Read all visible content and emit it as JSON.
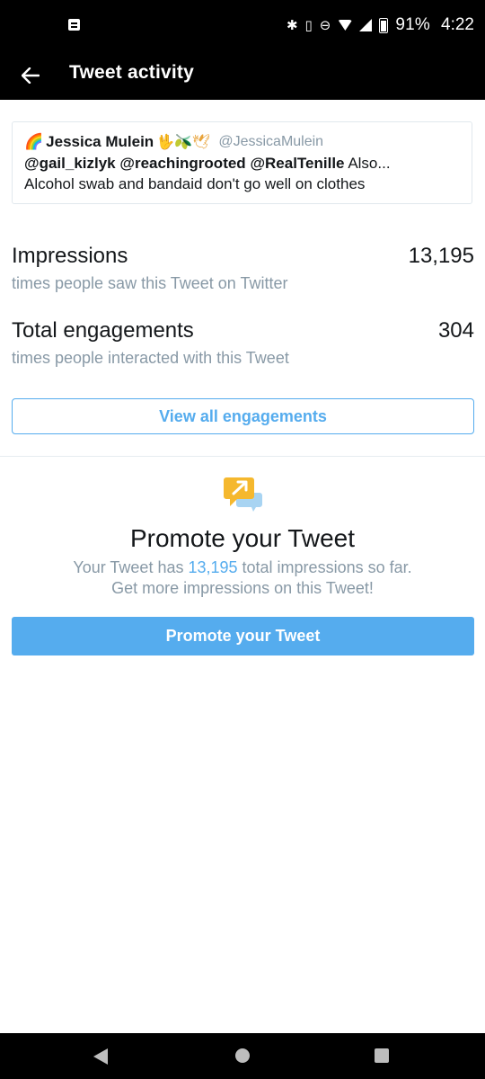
{
  "status_bar": {
    "battery": "91%",
    "time": "4:22",
    "icons": [
      "notification-icon",
      "bluetooth-icon",
      "vibrate-icon",
      "dnd-icon",
      "wifi-icon",
      "signal-icon",
      "battery-icon"
    ]
  },
  "app_bar": {
    "title": "Tweet activity",
    "back_icon": "arrow-left-icon"
  },
  "tweet": {
    "author_emoji_prefix": "🌈",
    "author_name": "Jessica Mulein",
    "author_emoji_suffix": "🖖🫒🕊",
    "handle": "@JessicaMulein",
    "mention1": "@gail_kizlyk",
    "mention2": "@reachingrooted",
    "mention3": "@RealTenille",
    "text_tail": "Also...",
    "line2": "Alcohol swab and bandaid don't go well on clothes"
  },
  "stats": {
    "impressions_label": "Impressions",
    "impressions_value": "13,195",
    "impressions_sub": "times people saw this Tweet on Twitter",
    "engagements_label": "Total engagements",
    "engagements_value": "304",
    "engagements_sub": "times people interacted with this Tweet"
  },
  "view_all_label": "View all engagements",
  "promo": {
    "title": "Promote your Tweet",
    "text_prefix": "Your Tweet has ",
    "text_count": "13,195",
    "text_suffix": " total impressions so far.",
    "line2": "Get more impressions on this Tweet!",
    "button_label": "Promote your Tweet",
    "icon": "promote-arrow-icon",
    "colors": {
      "accent": "#55acee",
      "icon_primary": "#f5b82e",
      "icon_secondary": "#a8d4f2"
    }
  },
  "nav": {
    "icons": [
      "back-triangle-icon",
      "home-circle-icon",
      "recents-square-icon"
    ]
  }
}
